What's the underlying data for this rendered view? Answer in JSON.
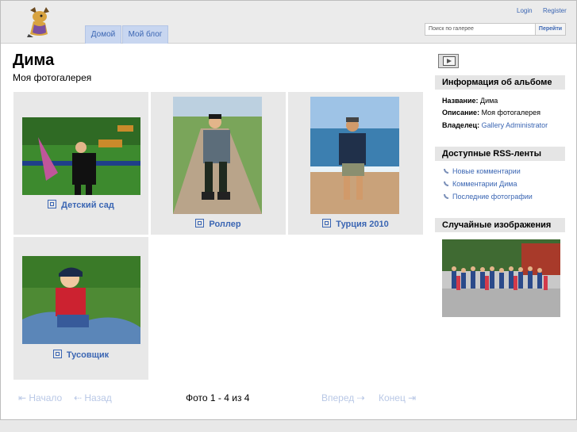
{
  "header": {
    "tabs": [
      {
        "label": "Домой"
      },
      {
        "label": "Мой блог"
      }
    ],
    "login": "Login",
    "register": "Register",
    "search_placeholder": "Поиск по галерее",
    "search_button": "Перейти"
  },
  "album": {
    "title": "Дима",
    "description": "Моя фотогалерея"
  },
  "items": [
    {
      "caption": "Детский сад"
    },
    {
      "caption": "Роллер"
    },
    {
      "caption": "Турция 2010"
    },
    {
      "caption": "Тусовщик"
    }
  ],
  "pager": {
    "first": "Начало",
    "prev": "Назад",
    "count": "Фото 1 - 4 из 4",
    "next": "Вперед",
    "last": "Конец"
  },
  "sidebar": {
    "info_title": "Информация об альбоме",
    "name_label": "Название:",
    "name_value": "Дима",
    "desc_label": "Описание:",
    "desc_value": "Моя фотогалерея",
    "owner_label": "Владелец:",
    "owner_value": "Gallery Administrator",
    "rss_title": "Доступные RSS-ленты",
    "rss": [
      {
        "label": "Новые комментарии"
      },
      {
        "label": "Комментарии Дима"
      },
      {
        "label": "Последние фотографии"
      }
    ],
    "random_title": "Случайные изображения"
  }
}
